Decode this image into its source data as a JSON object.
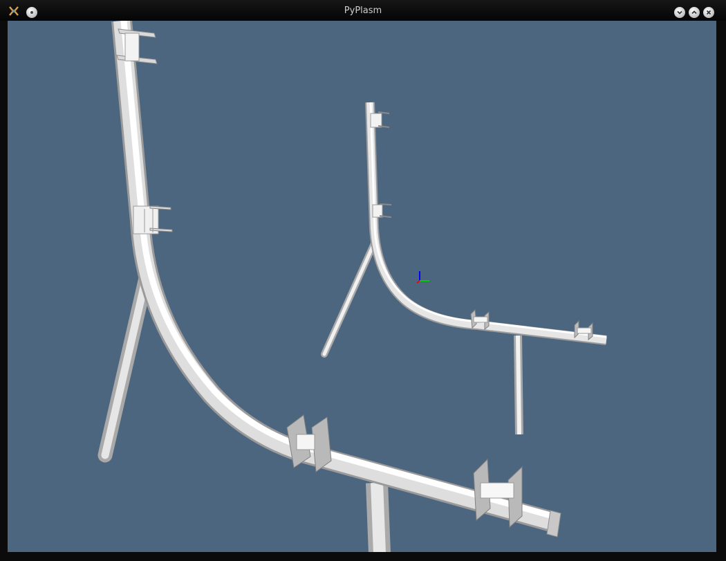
{
  "window": {
    "title": "PyPlasm",
    "controls": [
      "minimize",
      "maximize",
      "close"
    ]
  },
  "colors": {
    "viewport_background": "#4d6680",
    "model": "#eeeeee",
    "axis_x": "#ff0000",
    "axis_y": "#00cc00",
    "axis_z": "#0000ff"
  },
  "icons": {
    "app": "pyplasm-app-icon",
    "menu": "window-menu-icon",
    "minimize": "chevron-down-icon",
    "maximize": "chevron-up-icon",
    "close": "close-icon"
  }
}
